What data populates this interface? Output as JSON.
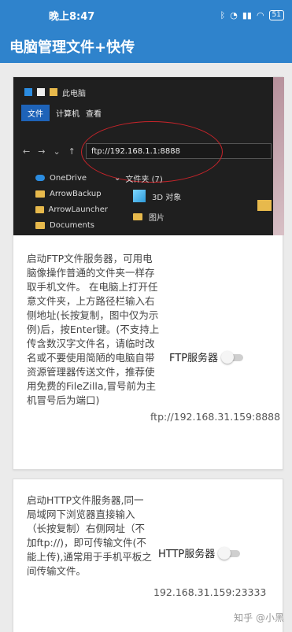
{
  "statusbar": {
    "time": "晚上8:47",
    "battery": "51"
  },
  "appbar": {
    "title": "电脑管理文件+快传"
  },
  "ftp_card": {
    "explorer": {
      "window_title": "此电脑",
      "menu": [
        "文件",
        "计算机",
        "查看"
      ],
      "address": "ftp://192.168.1.1:8888",
      "sidebar": [
        "OneDrive",
        "ArrowBackup",
        "ArrowLauncher",
        "Documents"
      ],
      "section": "文件夹 (7)",
      "items": [
        "3D 对象",
        "图片"
      ]
    },
    "description": "启动FTP文件服务器，可用电脑像操作普通的文件夹一样存取手机文件。 在电脑上打开任意文件夹，上方路径栏输入右侧地址(长按复制，图中仅为示例)后，按Enter键。(不支持上传含数汉字文件名，请临时改名或不要使用简陋的电脑自带资源管理器传送文件，推荐使用免费的FileZilla,冒号前为主机冒号后为端口)",
    "server_label": "FTP服务器",
    "toggle_on": false,
    "address": "ftp://192.168.31.159:8888"
  },
  "http_card": {
    "description": "启动HTTP文件服务器,同一局域网下浏览器直接输入（长按复制）右侧网址（不加ftp://)，即可传输文件(不能上传),通常用于手机平板之间传输文件。",
    "server_label": "HTTP服务器",
    "toggle_on": false,
    "address": "192.168.31.159:23333"
  },
  "watermark": "知乎 @小黑"
}
